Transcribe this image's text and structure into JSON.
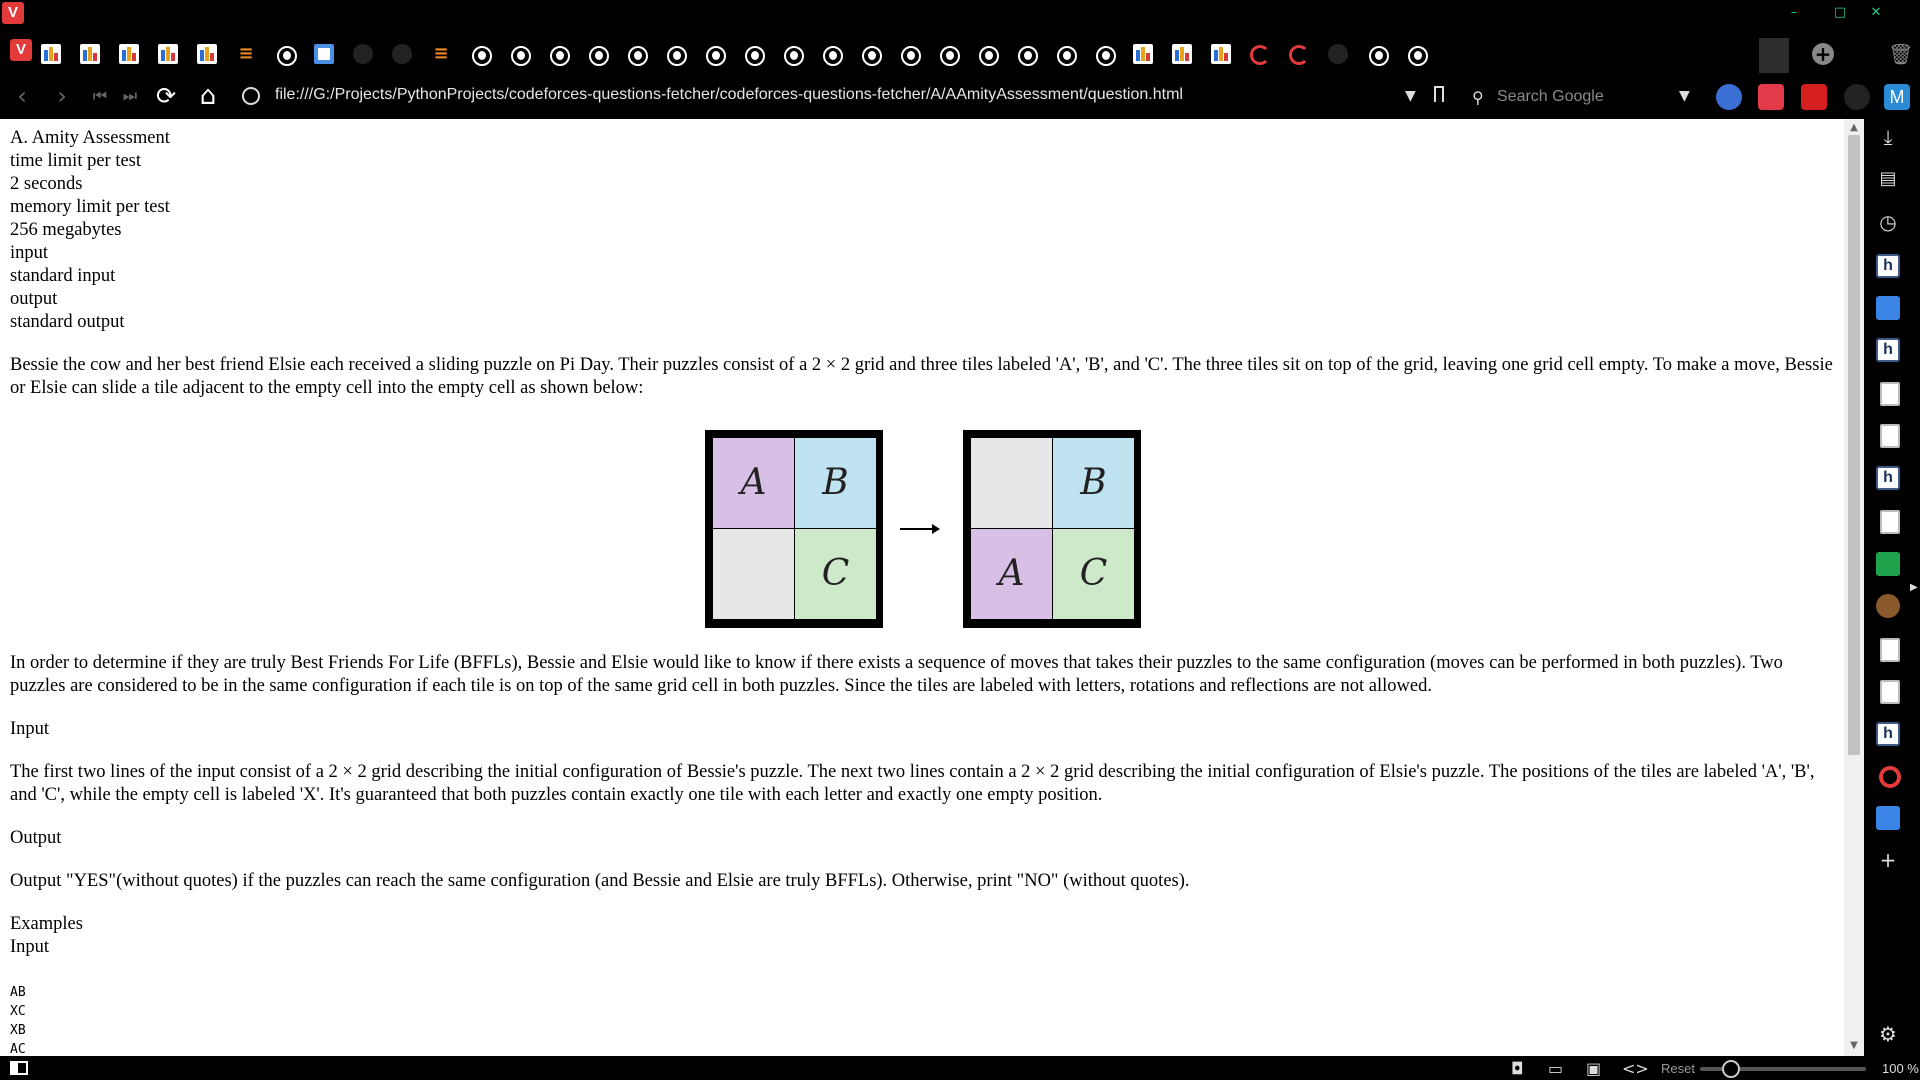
{
  "browser": {
    "url": "file:///G:/Projects/PythonProjects/codeforces-questions-fetcher/codeforces-questions-fetcher/A/AAmityAssessment/question.html",
    "search_placeholder": "Search Google",
    "zoom_reset_label": "Reset",
    "zoom_value": "100 %",
    "zoom_level": 1.0,
    "logo_letter": "V",
    "accent_color": "#e33a3a"
  },
  "page": {
    "header_lines": [
      "A. Amity Assessment",
      "time limit per test",
      "2 seconds",
      "memory limit per test",
      "256 megabytes",
      "input",
      "standard input",
      "output",
      "standard output"
    ],
    "intro": "Bessie the cow and her best friend Elsie each received a sliding puzzle on Pi Day. Their puzzles consist of a 2 × 2 grid and three tiles labeled 'A', 'B', and 'C'. The three tiles sit on top of the grid, leaving one grid cell empty. To make a move, Bessie or Elsie can slide a tile adjacent to the empty cell into the empty cell as shown below:",
    "figure": {
      "left_grid": [
        "A",
        "B",
        "",
        "C"
      ],
      "right_grid": [
        "",
        "B",
        "A",
        "C"
      ]
    },
    "after_figure": "In order to determine if they are truly Best Friends For Life (BFFLs), Bessie and Elsie would like to know if there exists a sequence of moves that takes their puzzles to the same configuration (moves can be performed in both puzzles). Two puzzles are considered to be in the same configuration if each tile is on top of the same grid cell in both puzzles. Since the tiles are labeled with letters, rotations and reflections are not allowed.",
    "input_heading": "Input",
    "input_text": "The first two lines of the input consist of a 2 × 2 grid describing the initial configuration of Bessie's puzzle. The next two lines contain a 2 × 2 grid describing the initial configuration of Elsie's puzzle. The positions of the tiles are labeled 'A', 'B', and 'C', while the empty cell is labeled 'X'. It's guaranteed that both puzzles contain exactly one tile with each letter and exactly one empty position.",
    "output_heading": "Output",
    "output_text": "Output \"YES\"(without quotes) if the puzzles can reach the same configuration (and Bessie and Elsie are truly BFFLs). Otherwise, print \"NO\" (without quotes).",
    "examples_heading": "Examples",
    "examples_input_heading": "Input",
    "example_input": "AB\nXC\nXB\nAC"
  },
  "tabs": [
    "chart",
    "chart",
    "chart",
    "chart",
    "chart",
    "so",
    "globe",
    "doc",
    "gh",
    "gh",
    "so",
    "globe",
    "globe",
    "globe",
    "globe",
    "globe",
    "globe",
    "globe",
    "globe",
    "globe",
    "globe",
    "globe",
    "globe",
    "globe",
    "globe",
    "globe",
    "globe",
    "globe",
    "chart",
    "chart",
    "chart",
    "sync",
    "sync",
    "gh",
    "globe",
    "globe"
  ]
}
